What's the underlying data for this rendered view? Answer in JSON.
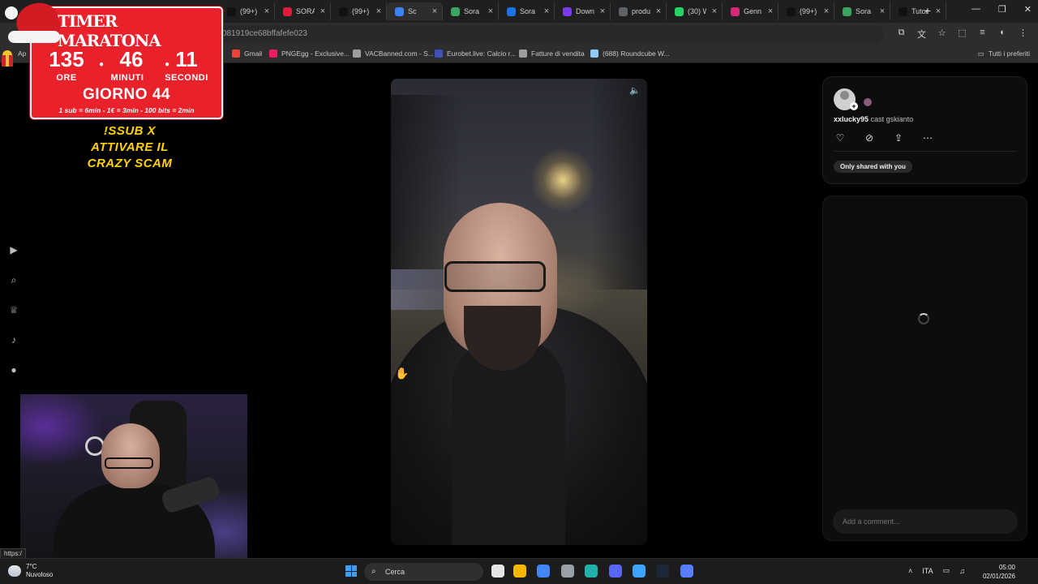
{
  "browser": {
    "tabs": [
      {
        "label": "(99+)",
        "color": "#111111"
      },
      {
        "label": "SORA",
        "color": "#e31b3a"
      },
      {
        "label": "(99+)",
        "color": "#111111"
      },
      {
        "label": "Sc",
        "color": "#3b82f6"
      },
      {
        "label": "Sora",
        "color": "#3aa35f"
      },
      {
        "label": "Sora",
        "color": "#1a73e8"
      },
      {
        "label": "Down",
        "color": "#7c3aed"
      },
      {
        "label": "produ",
        "color": "#5f6368"
      },
      {
        "label": "(30) W",
        "color": "#25d366"
      },
      {
        "label": "Genn",
        "color": "#d62976"
      },
      {
        "label": "(99+)",
        "color": "#111111"
      },
      {
        "label": "Sora",
        "color": "#3aa35f"
      },
      {
        "label": "Tutor",
        "color": "#111111"
      }
    ],
    "address": {
      "url": "081919ce68bffafefe023"
    },
    "bookmarks": [
      {
        "label": "Gmail",
        "color": "#ea4335"
      },
      {
        "label": "PNGEgg - Exclusive...",
        "color": "#e91e63"
      },
      {
        "label": "VACBanned.com - S...",
        "color": "#9e9e9e"
      },
      {
        "label": "Eurobet.live: Calcio r...",
        "color": "#3f51b5"
      },
      {
        "label": "Fatture di vendita",
        "color": "#9e9e9e"
      },
      {
        "label": "(688) Roundcube W...",
        "color": "#90caf9"
      }
    ],
    "bookmarks_all": "Tutti i preferiti",
    "bookmarks_apps": "Ap"
  },
  "timer_overlay": {
    "title": "TIMER MARATONA",
    "hours": "135",
    "minutes": "46",
    "seconds": "11",
    "hours_label": "ORE",
    "minutes_label": "MINUTI",
    "seconds_label": "SECONDI",
    "day_label": "GIORNO 44",
    "rules": "1 sub = 6min - 1€ = 3min - 100 bits = 2min"
  },
  "promo": {
    "line1": "!SSUB X",
    "line2": "ATTIVARE IL",
    "line3": "CRAZY SCAM"
  },
  "post": {
    "author": "xxlucky95",
    "cast_text": "cast gskianto",
    "visibility": "Only shared with you",
    "comment_placeholder": "Add a comment..."
  },
  "status_url": "https:/",
  "taskbar": {
    "weather_temp": "7°C",
    "weather_desc": "Nuvoloso",
    "search_label": "Cerca",
    "language": "ITA",
    "time": "05:00",
    "date": "02/01/2026",
    "apps": [
      "#e6e6e6",
      "#f5b700",
      "#4285f4",
      "#9aa0a6",
      "#20b2aa",
      "#5865f2",
      "#3ca4ff",
      "#1b2838",
      "#5a7cff"
    ]
  }
}
